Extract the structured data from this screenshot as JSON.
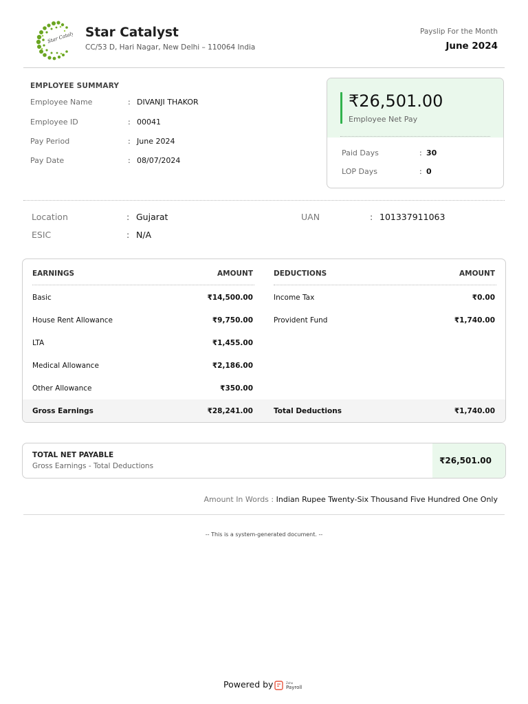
{
  "company": {
    "logo_text": "Star Catalyst",
    "name": "Star Catalyst",
    "address": "CC/53 D, Hari Nagar, New Delhi – 110064 India"
  },
  "payslip": {
    "label": "Payslip For the Month",
    "month": "June 2024"
  },
  "employee_summary": {
    "title": "EMPLOYEE SUMMARY",
    "rows": [
      {
        "label": "Employee Name",
        "value": "DIVANJI THAKOR"
      },
      {
        "label": "Employee ID",
        "value": "00041"
      },
      {
        "label": "Pay Period",
        "value": "June 2024"
      },
      {
        "label": "Pay Date",
        "value": "08/07/2024"
      }
    ]
  },
  "net_pay_card": {
    "amount": "₹26,501.00",
    "label": "Employee Net Pay",
    "rows": [
      {
        "label": "Paid Days",
        "value": "30"
      },
      {
        "label": "LOP Days",
        "value": "0"
      }
    ],
    "accent_color": "#31b24d",
    "bg_color": "#eaf8ec"
  },
  "extra_info": [
    {
      "label": "Location",
      "value": "Gujarat"
    },
    {
      "label": "UAN",
      "value": "101337911063"
    },
    {
      "label": "ESIC",
      "value": "N/A"
    }
  ],
  "earnings": {
    "header": "EARNINGS",
    "amount_header": "AMOUNT",
    "items": [
      {
        "label": "Basic",
        "amount": "₹14,500.00"
      },
      {
        "label": "House Rent Allowance",
        "amount": "₹9,750.00"
      },
      {
        "label": "LTA",
        "amount": "₹1,455.00"
      },
      {
        "label": "Medical Allowance",
        "amount": "₹2,186.00"
      },
      {
        "label": "Other Allowance",
        "amount": "₹350.00"
      }
    ],
    "total_label": "Gross Earnings",
    "total_amount": "₹28,241.00"
  },
  "deductions": {
    "header": "DEDUCTIONS",
    "amount_header": "AMOUNT",
    "items": [
      {
        "label": "Income Tax",
        "amount": "₹0.00"
      },
      {
        "label": "Provident Fund",
        "amount": "₹1,740.00"
      }
    ],
    "total_label": "Total Deductions",
    "total_amount": "₹1,740.00"
  },
  "total_net_payable": {
    "title": "TOTAL NET PAYABLE",
    "subtitle": "Gross Earnings - Total Deductions",
    "amount": "₹26,501.00"
  },
  "amount_in_words": {
    "label": "Amount In Words :",
    "value": "Indian Rupee Twenty-Six Thousand Five Hundred One Only"
  },
  "system_note": "-- This is a system-generated document. --",
  "footer": {
    "powered_by": "Powered by",
    "brand_small": "Zoho",
    "brand": "Payroll"
  }
}
